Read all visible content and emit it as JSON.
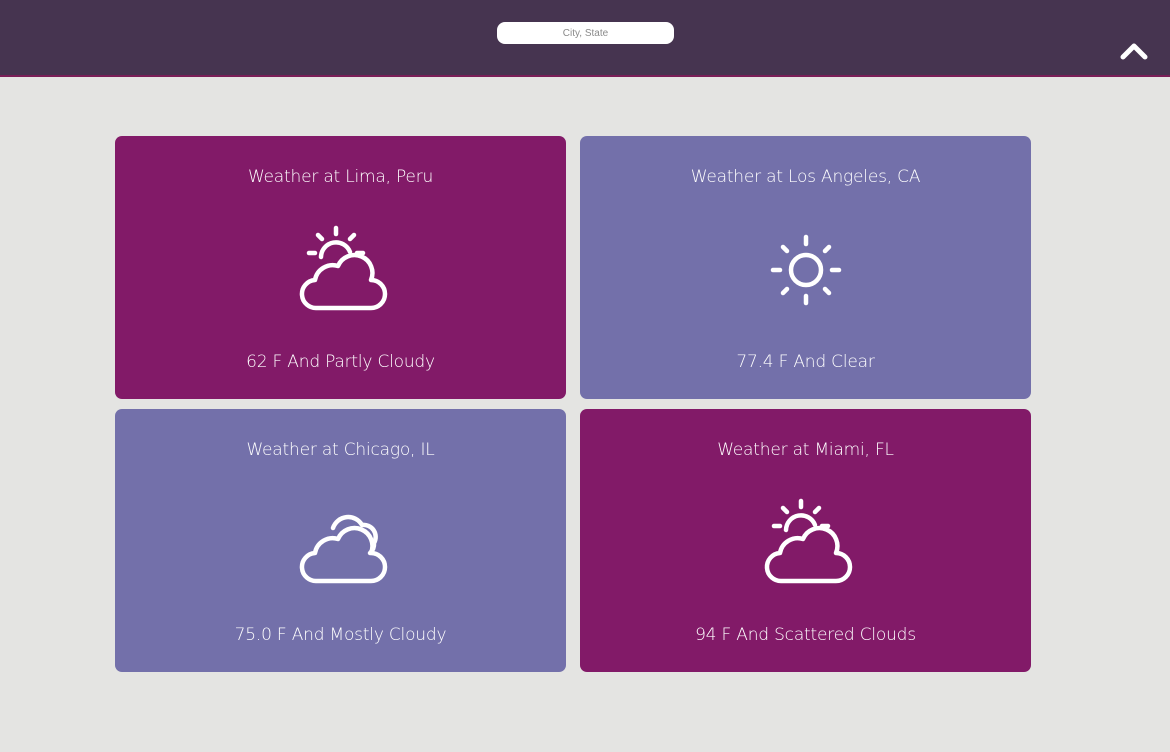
{
  "search": {
    "placeholder": "City, State",
    "value": ""
  },
  "header": {
    "collapse_icon": "chevron-up-icon"
  },
  "cards": [
    {
      "title": "Weather at Lima, Peru",
      "conditions": "62 F And Partly Cloudy",
      "icon": "partly-cloudy-icon",
      "color": "#821a68"
    },
    {
      "title": "Weather at Los Angeles, CA",
      "conditions": "77.4 F And Clear",
      "icon": "sun-icon",
      "color": "#7370aa"
    },
    {
      "title": "Weather at Chicago, IL",
      "conditions": "75.0 F And Mostly Cloudy",
      "icon": "cloudy-icon",
      "color": "#7370aa"
    },
    {
      "title": "Weather at Miami, FL",
      "conditions": "94 F And Scattered Clouds",
      "icon": "partly-cloudy-icon",
      "color": "#821a68"
    }
  ],
  "colors": {
    "header": "#463450",
    "accent": "#821a68",
    "secondary": "#7370aa",
    "background": "#e4e4e2"
  }
}
